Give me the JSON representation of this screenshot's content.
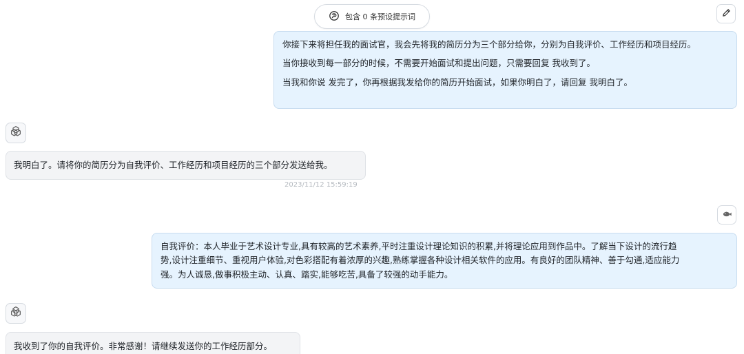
{
  "preset_prompts": {
    "label": "包含 0 条预设提示词"
  },
  "messages": [
    {
      "role": "user",
      "paragraphs": [
        "你接下来将担任我的面试官，我会先将我的简历分为三个部分给你，分别为自我评价、工作经历和项目经历。",
        "当你接收到每一部分的时候，不需要开始面试和提出问题，只需要回复 我收到了。",
        "当我和你说 发完了，你再根据我发给你的简历开始面试，如果你明白了，请回复 我明白了。"
      ]
    },
    {
      "role": "assistant",
      "text": "我明白了。请将你的简历分为自我评价、工作经历和项目经历的三个部分发送给我。",
      "timestamp": "2023/11/12 15:59:19"
    },
    {
      "role": "user",
      "lines": [
        "自我评价：本人毕业于艺术设计专业,具有较高的艺术素养,平时注重设计理论知识的积累,并将理论应用到作品中。了解当下设计的流行趋",
        "势,设计注重细节、重视用户体验,对色彩搭配有着浓厚的兴趣,熟练掌握各种设计相关软件的应用。有良好的团队精神、善于勾通,适应能力",
        "强。为人诚恳,做事积极主动、认真、踏实,能够吃苦,具备了较强的动手能力。"
      ]
    },
    {
      "role": "assistant",
      "text": "我收到了你的自我评价。非常感谢！请继续发送你的工作经历部分。"
    }
  ],
  "icons": {
    "preset": "prompt-icon",
    "edit": "pencil-icon",
    "user_avatar": "user-avatar-icon",
    "bot_avatar": "openai-icon"
  },
  "colors": {
    "user_bubble": "#e6f3fe",
    "bot_bubble": "#f3f4f6",
    "timestamp": "#b4b9bf"
  }
}
